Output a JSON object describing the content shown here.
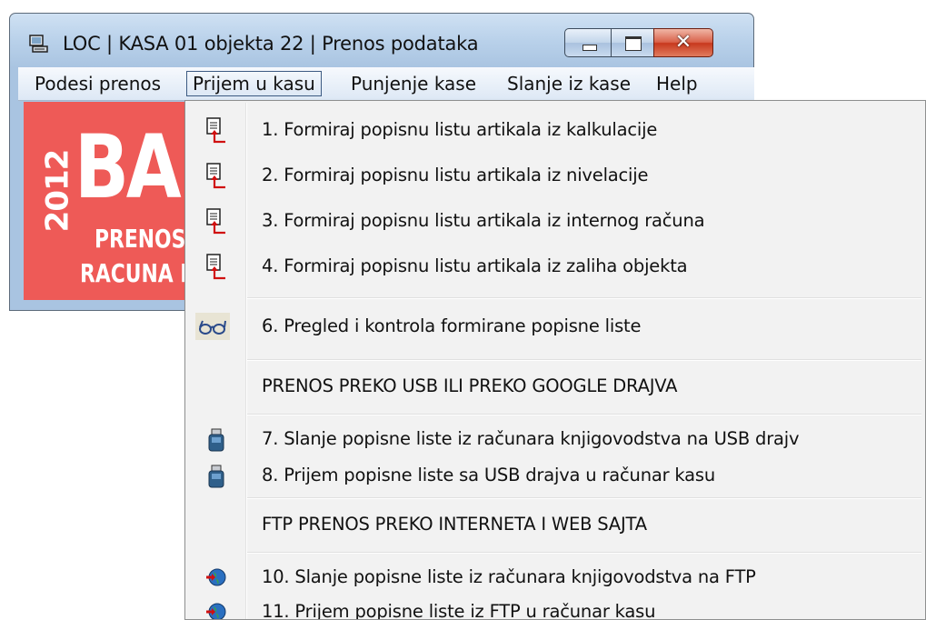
{
  "window": {
    "title": "LOC |  KASA 01 objekta 22 | Prenos podataka"
  },
  "menubar": {
    "items": [
      {
        "label": "Podesi prenos"
      },
      {
        "label": "Prijem u kasu"
      },
      {
        "label": "Punjenje kase"
      },
      {
        "label": "Slanje iz kase"
      },
      {
        "label": "Help"
      }
    ]
  },
  "banner": {
    "year": "2012",
    "big": "BA",
    "line1": "PRENOS",
    "line2": "RACUNA I"
  },
  "dropdown": {
    "items": [
      {
        "label": "1. Formiraj popisnu listu artikala iz kalkulacije",
        "icon": "document-arrow-icon"
      },
      {
        "label": "2. Formiraj popisnu listu artikala iz nivelacije",
        "icon": "document-arrow-icon"
      },
      {
        "label": "3. Formiraj popisnu listu artikala iz internog računa",
        "icon": "document-arrow-icon"
      },
      {
        "label": "4. Formiraj popisnu listu artikala iz zaliha objekta",
        "icon": "document-arrow-icon"
      },
      {
        "label": "6. Pregled i kontrola formirane popisne liste",
        "icon": "glasses-icon"
      },
      {
        "label": "PRENOS PREKO USB ILI PREKO GOOGLE DRAJVA",
        "icon": ""
      },
      {
        "label": "7. Slanje popisne liste iz računara knjigovodstva na USB drajv",
        "icon": "usb-drive-icon"
      },
      {
        "label": "8. Prijem popisne liste sa USB drajva u računar kasu",
        "icon": "usb-drive-icon"
      },
      {
        "label": "FTP PRENOS PREKO INTERNETA I WEB SAJTA",
        "icon": ""
      },
      {
        "label": "10. Slanje popisne liste iz računara knjigovodstva na FTP",
        "icon": "globe-arrow-icon"
      },
      {
        "label": "11. Prijem popisne liste iz FTP u računar kasu",
        "icon": "globe-arrow-icon"
      }
    ]
  }
}
